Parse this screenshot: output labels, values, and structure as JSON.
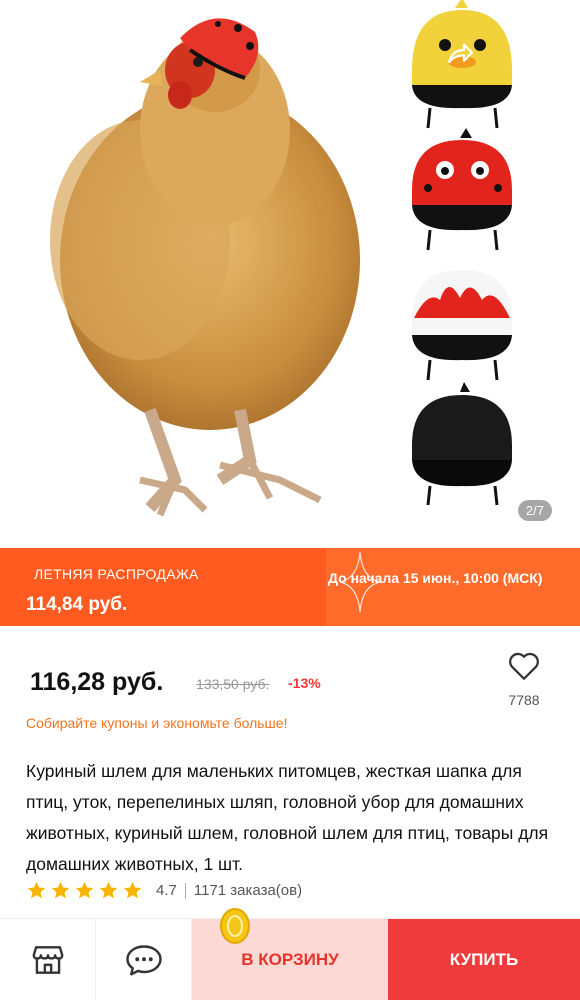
{
  "gallery": {
    "counter": "2/7",
    "icons": [
      "back-arrow-icon",
      "cart-icon",
      "share-icon",
      "more-icon"
    ]
  },
  "sale": {
    "title": "ЛЕТНЯЯ РАСПРОДАЖА",
    "price": "114,84 руб.",
    "time": "До начала 15 июн., 10:00 (МСК)"
  },
  "product": {
    "price": "116,28 руб.",
    "old_price": "133,50 руб.",
    "discount": "-13%",
    "favorites": "7788",
    "coupon": "Собирайте купоны и экономьте больше!",
    "title": "Куриный шлем для маленьких питомцев, жесткая шапка для птиц, уток, перепелиных шляп, головной убор для домашних животных, куриный шлем, головной шлем для птиц, товары для домашних животных, 1 шт.",
    "rating": "4.7",
    "stars": 5,
    "orders": "1171 заказа(ов)"
  },
  "bottom": {
    "cart_label": "В КОРЗИНУ",
    "buy_label": "КУПИТЬ"
  },
  "colors": {
    "sale_bg": "#ff5a1f",
    "coupon": "#f2731f",
    "discount": "#ff3333",
    "buy": "#ef3b3b",
    "cart_bg": "#fdd9d5",
    "star": "#f7b500"
  }
}
